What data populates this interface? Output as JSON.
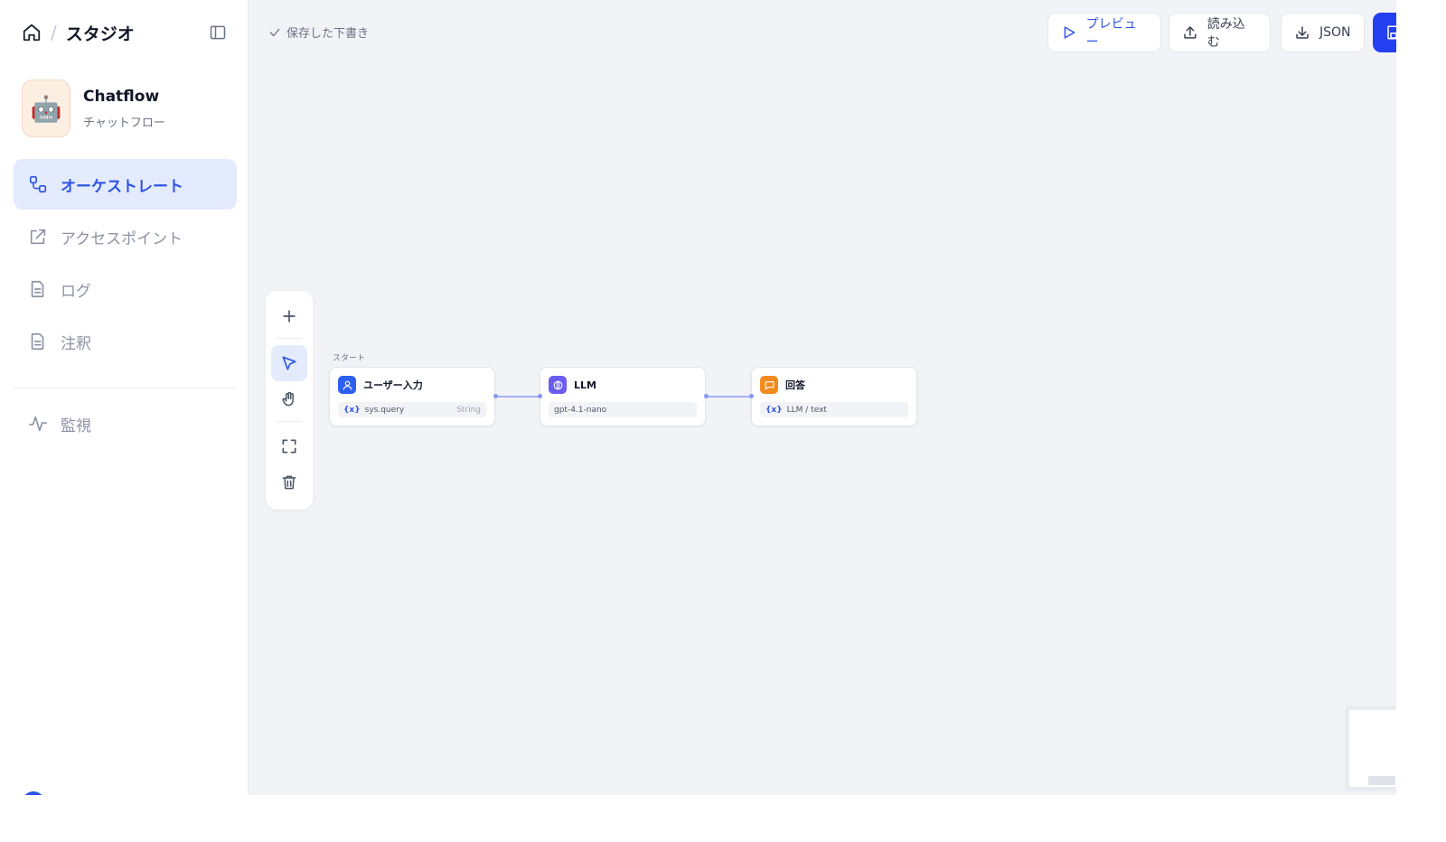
{
  "sidebar": {
    "breadcrumb": {
      "title": "スタジオ"
    },
    "app": {
      "avatar_emoji": "🤖",
      "name": "Chatflow",
      "type": "チャットフロー"
    },
    "nav": [
      {
        "label": "オーケストレート",
        "icon": "orchestrate-icon",
        "active": true
      },
      {
        "label": "アクセスポイント",
        "icon": "external-link-icon",
        "active": false
      },
      {
        "label": "ログ",
        "icon": "document-icon",
        "active": false
      },
      {
        "label": "注釈",
        "icon": "document-icon",
        "active": false
      },
      {
        "label": "監視",
        "icon": "activity-icon",
        "active": false
      }
    ]
  },
  "header": {
    "save_status": "保存した下書き",
    "buttons": {
      "preview": "プレビュー",
      "import": "読み込む",
      "export": "JSON"
    }
  },
  "canvas": {
    "start_label": "スタート",
    "nodes": [
      {
        "title": "ユーザー入力",
        "var_mark": "{x}",
        "var": "sys.query",
        "var_type": "String",
        "icon": "user-icon",
        "color": "#2f5ff0"
      },
      {
        "title": "LLM",
        "var": "gpt-4.1-nano",
        "icon": "llm-icon",
        "color": "#6b5cf0"
      },
      {
        "title": "回答",
        "var_mark": "{x}",
        "var": "LLM / text",
        "icon": "chat-icon",
        "color": "#f28a1e"
      }
    ]
  },
  "colors": {
    "accent": "#2f55e4",
    "canvas_bg": "#f2f3f7"
  }
}
